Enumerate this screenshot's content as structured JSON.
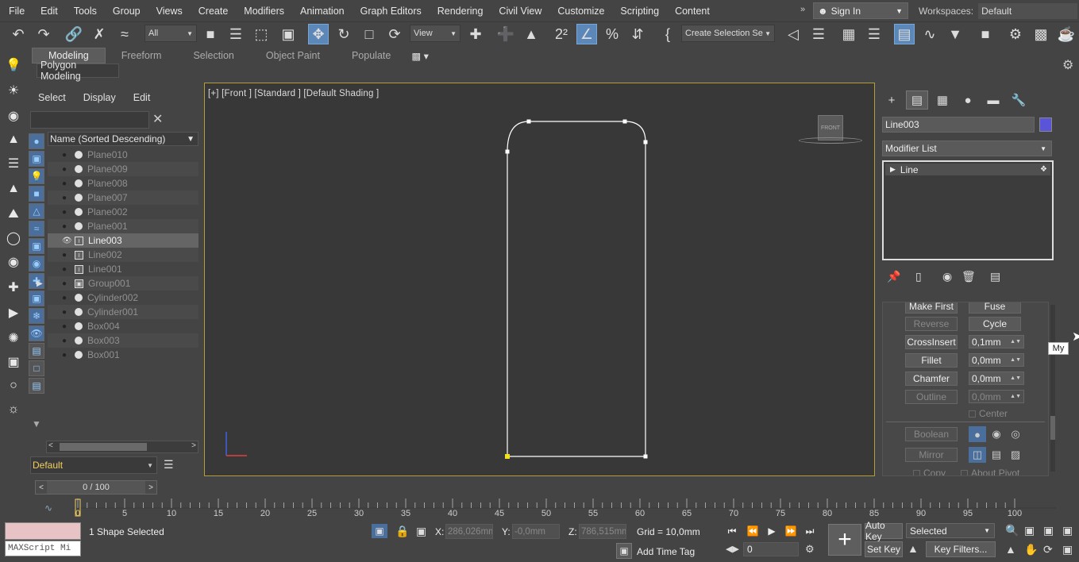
{
  "menu": [
    "File",
    "Edit",
    "Tools",
    "Group",
    "Views",
    "Create",
    "Modifiers",
    "Animation",
    "Graph Editors",
    "Rendering",
    "Civil View",
    "Customize",
    "Scripting",
    "Content"
  ],
  "menu_more": "»",
  "signin": "Sign In",
  "workspaces": {
    "label": "Workspaces:",
    "value": "Default"
  },
  "toolbar": {
    "selection_filter": "All",
    "ref_coord": "View",
    "named_selection": "Create Selection Se"
  },
  "ribbon": {
    "tabs": [
      "Modeling",
      "Freeform",
      "Selection",
      "Object Paint",
      "Populate"
    ],
    "active": "Modeling",
    "sub": "Polygon Modeling"
  },
  "scene": {
    "menu": [
      "Select",
      "Display",
      "Edit"
    ],
    "column": "Name (Sorted Descending)",
    "rows": [
      {
        "name": "Plane010",
        "type": "geo",
        "selected": false
      },
      {
        "name": "Plane009",
        "type": "geo",
        "selected": false
      },
      {
        "name": "Plane008",
        "type": "geo",
        "selected": false
      },
      {
        "name": "Plane007",
        "type": "geo",
        "selected": false
      },
      {
        "name": "Plane002",
        "type": "geo",
        "selected": false
      },
      {
        "name": "Plane001",
        "type": "geo",
        "selected": false
      },
      {
        "name": "Line003",
        "type": "shape",
        "selected": true
      },
      {
        "name": "Line002",
        "type": "shape",
        "selected": false
      },
      {
        "name": "Line001",
        "type": "shape",
        "selected": false
      },
      {
        "name": "Group001",
        "type": "group",
        "selected": false
      },
      {
        "name": "Cylinder002",
        "type": "geo",
        "selected": false
      },
      {
        "name": "Cylinder001",
        "type": "geo",
        "selected": false
      },
      {
        "name": "Box004",
        "type": "geo",
        "selected": false
      },
      {
        "name": "Box003",
        "type": "geo",
        "selected": false
      },
      {
        "name": "Box001",
        "type": "geo",
        "selected": false
      }
    ],
    "layer": "Default"
  },
  "viewport": {
    "label": "[+] [Front ] [Standard ] [Default Shading ]",
    "viewcube": "FRONT"
  },
  "command_panel": {
    "object_name": "Line003",
    "object_color": "#5a55d8",
    "modifier_list": "Modifier List",
    "stack_item": "Line",
    "rollout": {
      "make_first": "Make First",
      "fuse": "Fuse",
      "reverse": "Reverse",
      "cycle": "Cycle",
      "crossinsert": "CrossInsert",
      "crossinsert_val": "0,1mm",
      "fillet": "Fillet",
      "fillet_val": "0,0mm",
      "chamfer": "Chamfer",
      "chamfer_val": "0,0mm",
      "outline": "Outline",
      "outline_val": "0,0mm",
      "center": "Center",
      "boolean": "Boolean",
      "mirror": "Mirror",
      "copy": "Copy",
      "about_pivot": "About Pivot"
    }
  },
  "tooltip": "My",
  "timeslider": {
    "value": "0 / 100",
    "prev": "<",
    "next": ">"
  },
  "track_ticks": [
    "0",
    "5",
    "10",
    "15",
    "20",
    "25",
    "30",
    "35",
    "40",
    "45",
    "50",
    "55",
    "60",
    "65",
    "70",
    "75",
    "80",
    "85",
    "90",
    "95",
    "100"
  ],
  "status": {
    "maxscript": "MAXScript Mi",
    "selected": "1 Shape Selected",
    "x_label": "X:",
    "x_val": "286,026mm",
    "y_label": "Y:",
    "y_val": "-0,0mm",
    "z_label": "Z:",
    "z_val": "786,515mm",
    "grid": "Grid = 10,0mm",
    "add_time_tag": "Add Time Tag",
    "frame": "0",
    "auto_key": "Auto Key",
    "set_key": "Set Key",
    "key_filter_sel": "Selected",
    "key_filters": "Key Filters..."
  },
  "colors": {
    "accent": "#5b87b9",
    "viewport_border": "#b59d3c",
    "shape": "#ffffff",
    "vertex_first": "#f0e020"
  }
}
